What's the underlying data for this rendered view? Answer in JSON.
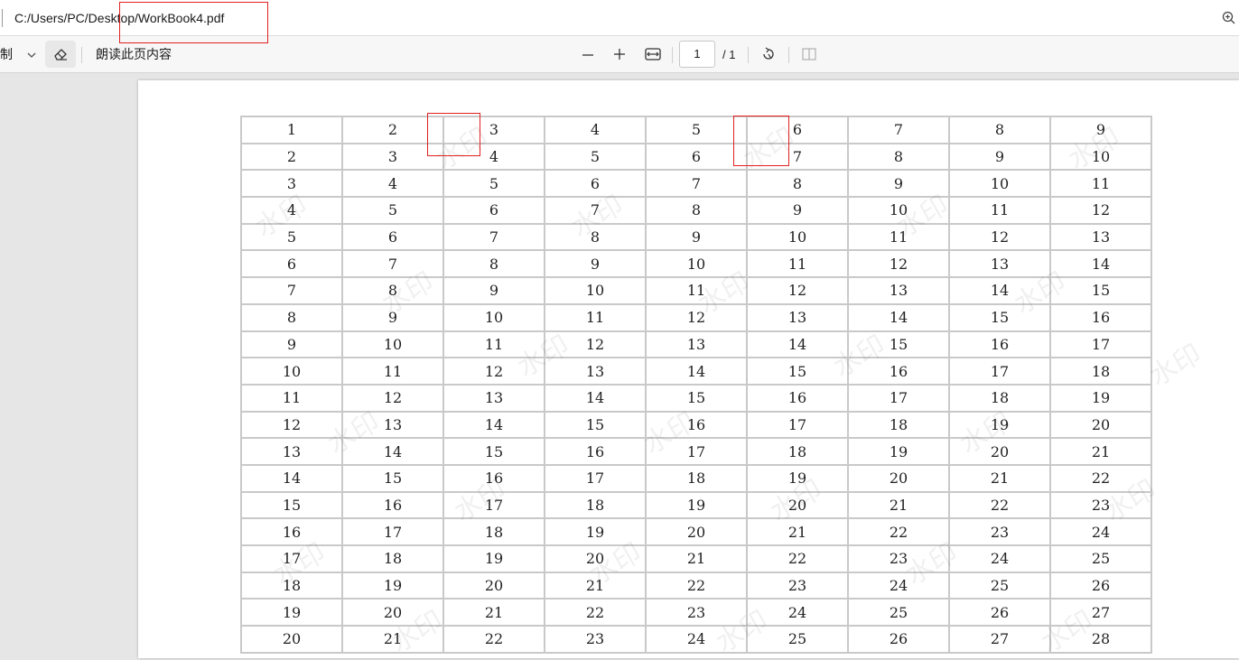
{
  "address_bar": {
    "path": "C:/Users/PC/Desktop/WorkBook4.pdf"
  },
  "toolbar": {
    "draw_label": "制",
    "read_aloud_label": "朗读此页内容",
    "page_current": "1",
    "page_total": "/ 1",
    "icons": [
      "chevron-down-icon",
      "eraser-icon",
      "minus-icon",
      "plus-icon",
      "fit-width-icon",
      "rotate-icon",
      "two-page-icon",
      "zoom-icon"
    ]
  },
  "document": {
    "watermark_text": "水印",
    "table": {
      "rows": [
        [
          "1",
          "2",
          "3",
          "4",
          "5",
          "6",
          "7",
          "8",
          "9"
        ],
        [
          "2",
          "3",
          "4",
          "5",
          "6",
          "7",
          "8",
          "9",
          "10"
        ],
        [
          "3",
          "4",
          "5",
          "6",
          "7",
          "8",
          "9",
          "10",
          "11"
        ],
        [
          "4",
          "5",
          "6",
          "7",
          "8",
          "9",
          "10",
          "11",
          "12"
        ],
        [
          "5",
          "6",
          "7",
          "8",
          "9",
          "10",
          "11",
          "12",
          "13"
        ],
        [
          "6",
          "7",
          "8",
          "9",
          "10",
          "11",
          "12",
          "13",
          "14"
        ],
        [
          "7",
          "8",
          "9",
          "10",
          "11",
          "12",
          "13",
          "14",
          "15"
        ],
        [
          "8",
          "9",
          "10",
          "11",
          "12",
          "13",
          "14",
          "15",
          "16"
        ],
        [
          "9",
          "10",
          "11",
          "12",
          "13",
          "14",
          "15",
          "16",
          "17"
        ],
        [
          "10",
          "11",
          "12",
          "13",
          "14",
          "15",
          "16",
          "17",
          "18"
        ],
        [
          "11",
          "12",
          "13",
          "14",
          "15",
          "16",
          "17",
          "18",
          "19"
        ],
        [
          "12",
          "13",
          "14",
          "15",
          "16",
          "17",
          "18",
          "19",
          "20"
        ],
        [
          "13",
          "14",
          "15",
          "16",
          "17",
          "18",
          "19",
          "20",
          "21"
        ],
        [
          "14",
          "15",
          "16",
          "17",
          "18",
          "19",
          "20",
          "21",
          "22"
        ],
        [
          "15",
          "16",
          "17",
          "18",
          "19",
          "20",
          "21",
          "22",
          "23"
        ],
        [
          "16",
          "17",
          "18",
          "19",
          "20",
          "21",
          "22",
          "23",
          "24"
        ],
        [
          "17",
          "18",
          "19",
          "20",
          "21",
          "22",
          "23",
          "24",
          "25"
        ],
        [
          "18",
          "19",
          "20",
          "21",
          "22",
          "23",
          "24",
          "25",
          "26"
        ],
        [
          "19",
          "20",
          "21",
          "22",
          "23",
          "24",
          "25",
          "26",
          "27"
        ],
        [
          "20",
          "21",
          "22",
          "23",
          "24",
          "25",
          "26",
          "27",
          "28"
        ]
      ]
    }
  },
  "colors": {
    "annotation": "#e02020",
    "grid_border": "#c9c9c9"
  }
}
